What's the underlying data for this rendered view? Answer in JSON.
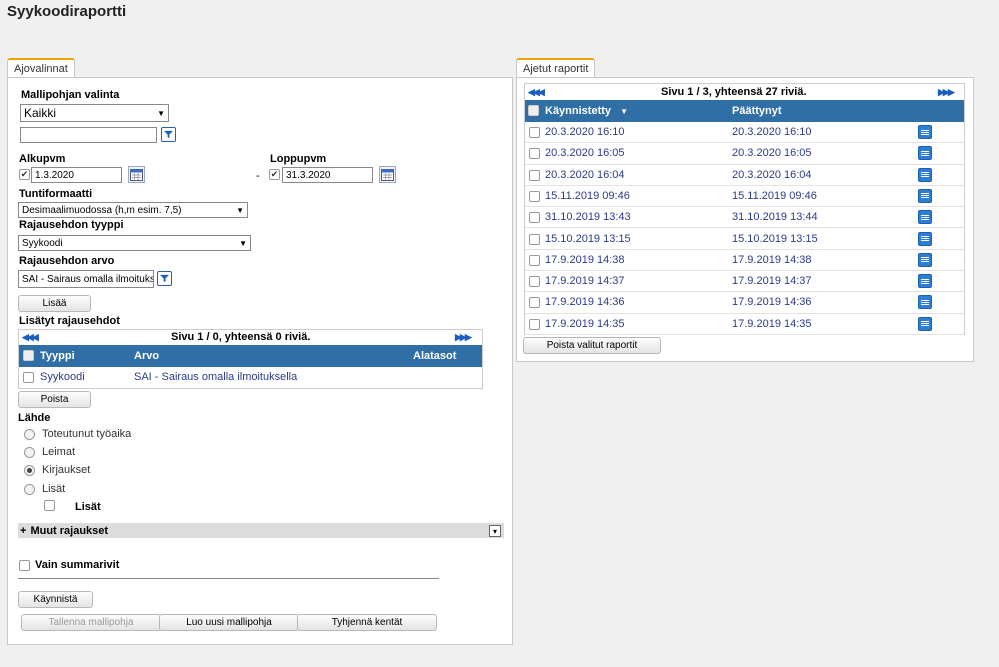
{
  "page": {
    "title": "Syykoodiraportti"
  },
  "left": {
    "tab": "Ajovalinnat",
    "template": {
      "label": "Mallipohjan valinta",
      "selected": "Kaikki",
      "filter_value": ""
    },
    "start": {
      "label": "Alkupvm",
      "value": "1.3.2020"
    },
    "end": {
      "label": "Loppupvm",
      "value": "31.3.2020"
    },
    "dash": "-",
    "hour_format": {
      "label": "Tuntiformaatti",
      "selected": "Desimaalimuodossa (h,m esim. 7,5)"
    },
    "cond_type": {
      "label": "Rajausehdon tyyppi",
      "selected": "Syykoodi"
    },
    "cond_value": {
      "label": "Rajausehdon arvo",
      "value": "SAI - Sairaus omalla ilmoituksella"
    },
    "add_button": "Lisää",
    "added": {
      "label": "Lisätyt rajausehdot",
      "pager": "Sivu 1 / 0, yhteensä 0 riviä.",
      "columns": [
        "Tyyppi",
        "Arvo",
        "Alatasot"
      ],
      "rows": [
        {
          "type": "Syykoodi",
          "value": "SAI - Sairaus omalla ilmoituksella",
          "sub": ""
        }
      ]
    },
    "remove_button": "Poista",
    "source": {
      "label": "Lähde",
      "options": [
        "Toteutunut työaika",
        "Leimat",
        "Kirjaukset",
        "Lisät"
      ],
      "selected": "Kirjaukset",
      "extra_checkbox": "Lisät"
    },
    "other": {
      "plus": "+",
      "label": "Muut rajaukset"
    },
    "summary_only": "Vain summarivit",
    "run_button": "Käynnistä",
    "save_template": "Tallenna mallipohja",
    "new_template": "Luo uusi mallipohja",
    "clear_fields": "Tyhjennä kentät"
  },
  "right": {
    "tab": "Ajetut raportit",
    "pager": "Sivu 1 / 3, yhteensä 27 riviä.",
    "columns": [
      "Käynnistetty",
      "Päättynyt"
    ],
    "sort_indicator": "▼",
    "rows": [
      {
        "start": "20.3.2020 16:10",
        "end": "20.3.2020 16:10"
      },
      {
        "start": "20.3.2020 16:05",
        "end": "20.3.2020 16:05"
      },
      {
        "start": "20.3.2020 16:04",
        "end": "20.3.2020 16:04"
      },
      {
        "start": "15.11.2019 09:46",
        "end": "15.11.2019 09:46"
      },
      {
        "start": "31.10.2019 13:43",
        "end": "31.10.2019 13:44"
      },
      {
        "start": "15.10.2019 13:15",
        "end": "15.10.2019 13:15"
      },
      {
        "start": "17.9.2019 14:38",
        "end": "17.9.2019 14:38"
      },
      {
        "start": "17.9.2019 14:37",
        "end": "17.9.2019 14:37"
      },
      {
        "start": "17.9.2019 14:36",
        "end": "17.9.2019 14:36"
      },
      {
        "start": "17.9.2019 14:35",
        "end": "17.9.2019 14:35"
      }
    ],
    "delete_button": "Poista valitut raportit"
  },
  "colors": {
    "accent": "#f0a000",
    "header": "#2f6fa6",
    "link": "#2a3b8a",
    "icon": "#2d7fd6"
  },
  "icons": {
    "first": "first-page-icon",
    "last": "last-page-icon",
    "calendar": "calendar-icon",
    "filter": "filter-icon",
    "report": "report-icon"
  }
}
